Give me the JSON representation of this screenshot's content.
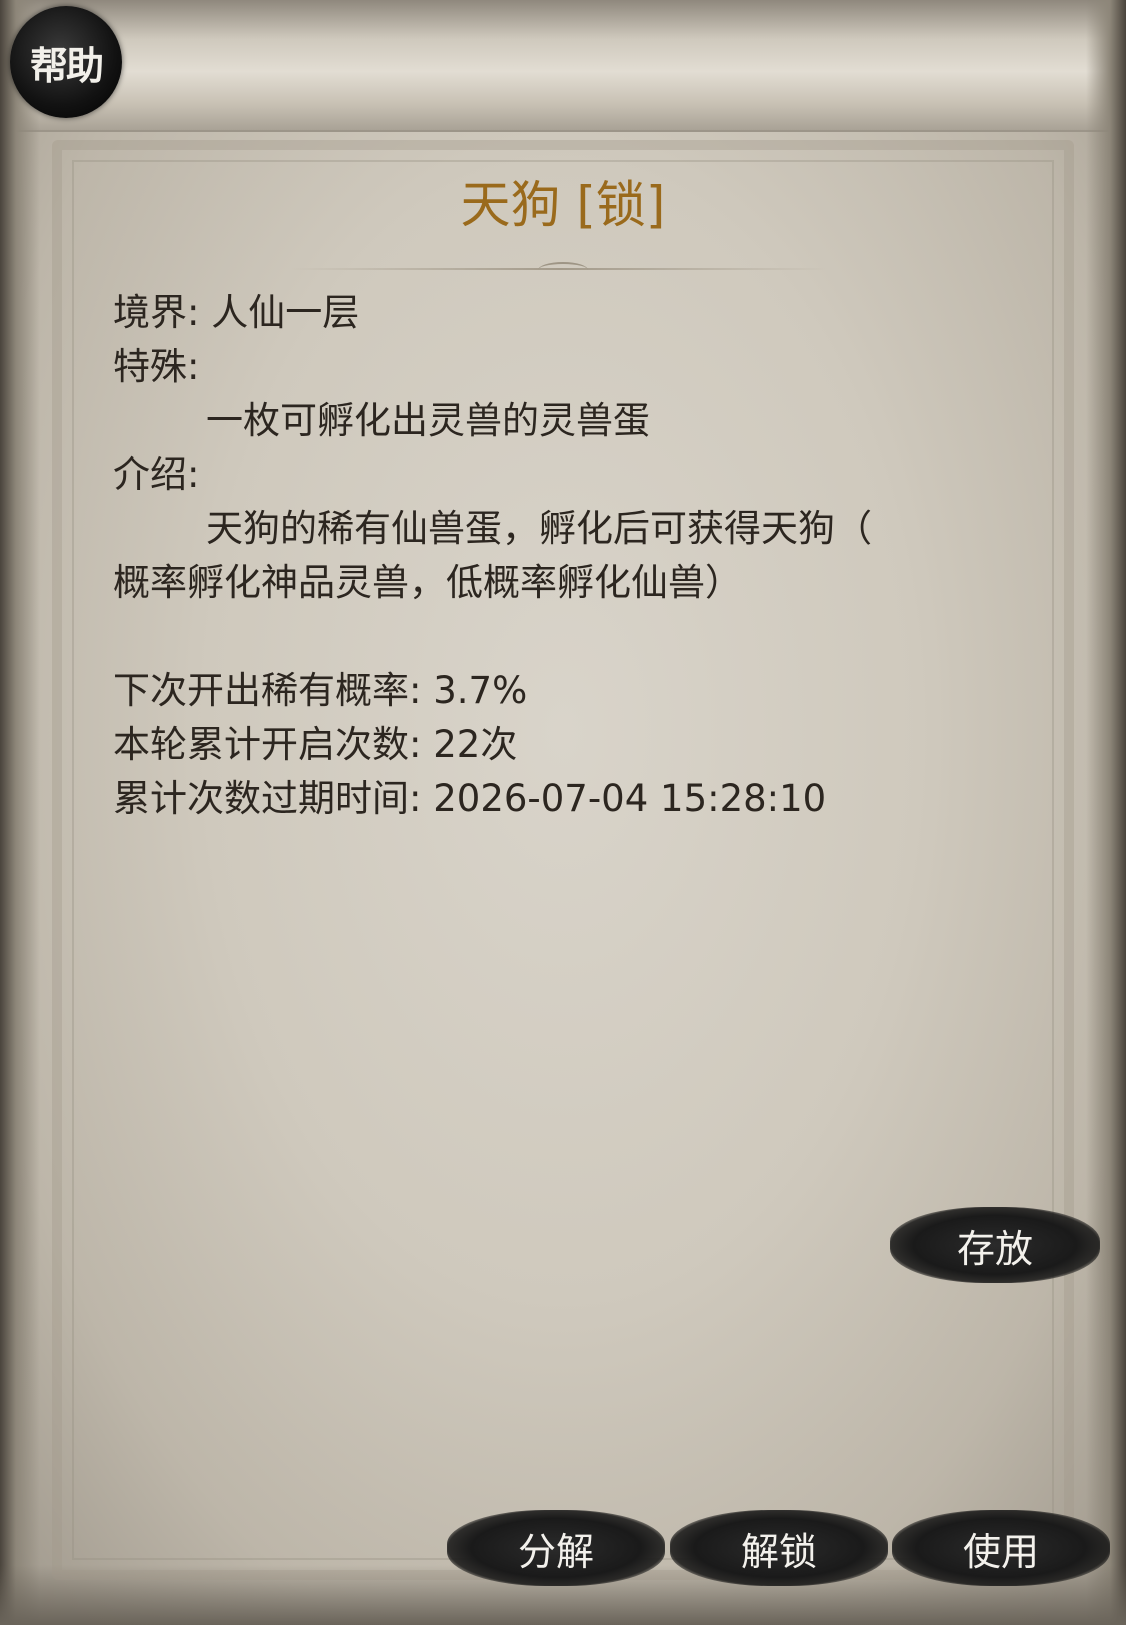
{
  "help_button": {
    "label": "帮助"
  },
  "item": {
    "title": "天狗 [锁]"
  },
  "details": {
    "realm_label": "境界:",
    "realm_value": "人仙一层",
    "special_label": "特殊:",
    "special_value": "一枚可孵化出灵兽的灵兽蛋",
    "intro_label": "介绍:",
    "intro_line1": "天狗的稀有仙兽蛋，孵化后可获得天狗（",
    "intro_line2": "概率孵化神品灵兽，低概率孵化仙兽）",
    "rare_rate_label": "下次开出稀有概率:",
    "rare_rate_value": "3.7%",
    "open_count_label": "本轮累计开启次数:",
    "open_count_value": "22次",
    "expire_label": "累计次数过期时间:",
    "expire_value": "2026-07-04 15:28:10"
  },
  "buttons": {
    "store": "存放",
    "decompose": "分解",
    "unlock": "解锁",
    "use": "使用"
  },
  "colors": {
    "title": "#9a6a1c",
    "body_text": "#2c2620",
    "button_ink": "#1a1a1a",
    "button_text": "#f3f1ec"
  }
}
